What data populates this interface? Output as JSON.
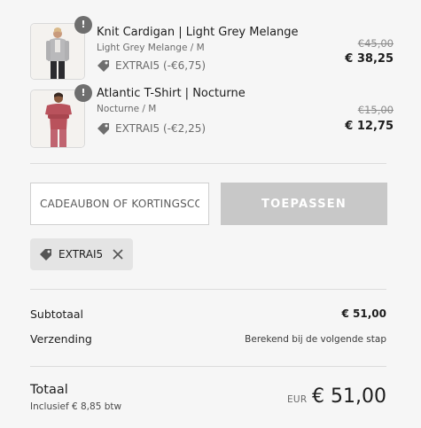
{
  "cart": {
    "items": [
      {
        "quantity_badge": "!",
        "name": "Knit Cardigan | Light Grey Melange",
        "variant": "Light Grey Melange / M",
        "discount": "EXTRAI5 (-€6,75)",
        "old_price": "€45,00",
        "new_price": "€ 38,25",
        "thumb_icon": "cardigan-product-photo"
      },
      {
        "quantity_badge": "!",
        "name": "Atlantic T-Shirt | Nocturne",
        "variant": "Nocturne / M",
        "discount": "EXTRAI5 (-€2,25)",
        "old_price": "€15,00",
        "new_price": "€ 12,75",
        "thumb_icon": "tshirt-product-photo"
      }
    ]
  },
  "discount_form": {
    "placeholder": "CADEAUBON OF KORTINGSCODE",
    "apply_label": "TOEPASSEN"
  },
  "applied_code": {
    "label": "EXTRAI5",
    "icon": "tag-icon",
    "remove_icon": "close-icon"
  },
  "summary": {
    "subtotal_label": "Subtotaal",
    "subtotal_value": "€ 51,00",
    "shipping_label": "Verzending",
    "shipping_value": "Berekend bij de volgende stap",
    "total_label": "Totaal",
    "tax_note": "Inclusief € 8,85 btw",
    "currency": "EUR",
    "total_value": "€ 51,00"
  },
  "colors": {
    "background": "#f6f6f6",
    "button_disabled": "#c8c8c8",
    "chip": "#e4e4e4",
    "badge": "#6e6e6e"
  }
}
